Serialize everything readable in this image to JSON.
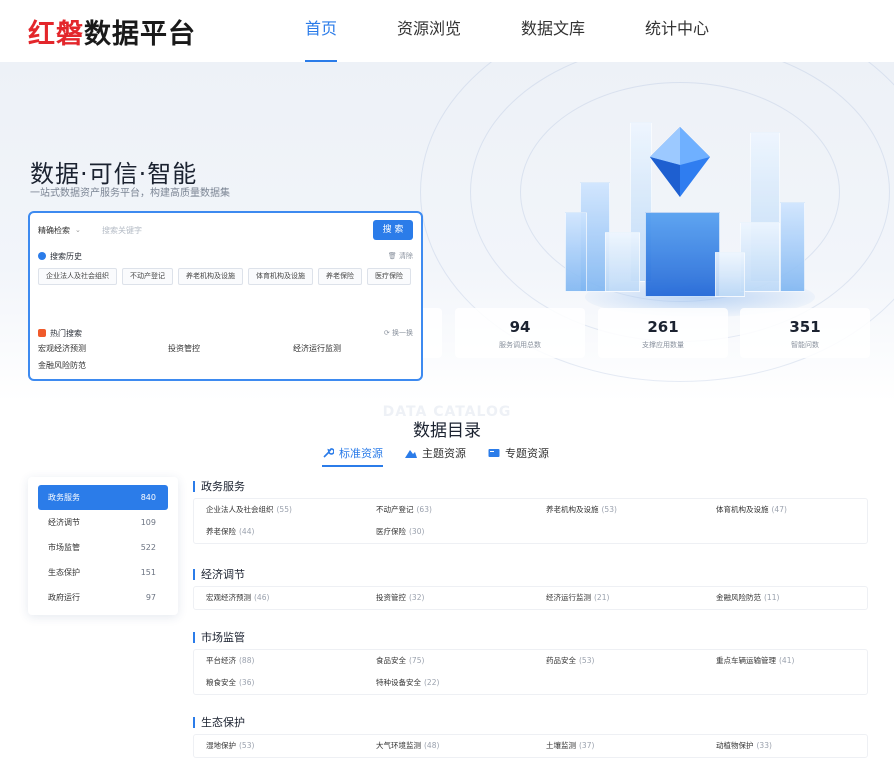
{
  "header": {
    "logo_red": "红磐",
    "logo_rest": "数据平台",
    "nav": [
      {
        "label": "首页",
        "active": true
      },
      {
        "label": "资源浏览",
        "active": false
      },
      {
        "label": "数据文库",
        "active": false
      },
      {
        "label": "统计中心",
        "active": false
      }
    ]
  },
  "hero": {
    "title": "数据·可信·智能",
    "subtitle": "一站式数据资产服务平台，构建高质量数据集"
  },
  "search": {
    "scope": "精确检索",
    "placeholder": "搜索关键字",
    "button": "搜 索",
    "history_label": "搜索历史",
    "history_clear": "清除",
    "history": [
      "企业法人及社会组织",
      "不动产登记",
      "养老机构及设施",
      "体育机构及设施",
      "养老保险",
      "医疗保险"
    ],
    "hot_label": "热门搜索",
    "hot_refresh": "换一换",
    "hot": [
      "宏观经济预测",
      "投资管控",
      "经济运行监测",
      "金融风险防范"
    ]
  },
  "stats": [
    {
      "value": "94",
      "label": "服务调用总数"
    },
    {
      "value": "261",
      "label": "支撑应用数量"
    },
    {
      "value": "351",
      "label": "智能问数"
    }
  ],
  "catalog": {
    "watermark": "DATA CATALOG",
    "title": "数据目录",
    "tabs": [
      {
        "label": "标准资源",
        "active": true,
        "icon": "wrench-icon"
      },
      {
        "label": "主题资源",
        "active": false,
        "icon": "mountain-icon"
      },
      {
        "label": "专题资源",
        "active": false,
        "icon": "image-icon"
      }
    ],
    "sidebar": [
      {
        "label": "政务服务",
        "count": "840",
        "active": true
      },
      {
        "label": "经济调节",
        "count": "109",
        "active": false
      },
      {
        "label": "市场监管",
        "count": "522",
        "active": false
      },
      {
        "label": "生态保护",
        "count": "151",
        "active": false
      },
      {
        "label": "政府运行",
        "count": "97",
        "active": false
      }
    ],
    "sections": [
      {
        "title": "政务服务",
        "items": [
          {
            "name": "企业法人及社会组织",
            "count": "(55)"
          },
          {
            "name": "不动产登记",
            "count": "(63)"
          },
          {
            "name": "养老机构及设施",
            "count": "(53)"
          },
          {
            "name": "体育机构及设施",
            "count": "(47)"
          },
          {
            "name": "养老保险",
            "count": "(44)"
          },
          {
            "name": "医疗保险",
            "count": "(30)"
          }
        ]
      },
      {
        "title": "经济调节",
        "items": [
          {
            "name": "宏观经济预测",
            "count": "(46)"
          },
          {
            "name": "投资管控",
            "count": "(32)"
          },
          {
            "name": "经济运行监测",
            "count": "(21)"
          },
          {
            "name": "金融风险防范",
            "count": "(11)"
          }
        ]
      },
      {
        "title": "市场监管",
        "items": [
          {
            "name": "平台经济",
            "count": "(88)"
          },
          {
            "name": "食品安全",
            "count": "(75)"
          },
          {
            "name": "药品安全",
            "count": "(53)"
          },
          {
            "name": "重点车辆运输管理",
            "count": "(41)"
          },
          {
            "name": "粮食安全",
            "count": "(36)"
          },
          {
            "name": "特种设备安全",
            "count": "(22)"
          }
        ]
      },
      {
        "title": "生态保护",
        "items": [
          {
            "name": "湿地保护",
            "count": "(53)"
          },
          {
            "name": "大气环境监测",
            "count": "(48)"
          },
          {
            "name": "土壤监测",
            "count": "(37)"
          },
          {
            "name": "动植物保护",
            "count": "(33)"
          }
        ]
      }
    ]
  },
  "colors": {
    "brand": "#2b7ce9",
    "logo_red": "#e3262b",
    "text": "#1b2230"
  }
}
